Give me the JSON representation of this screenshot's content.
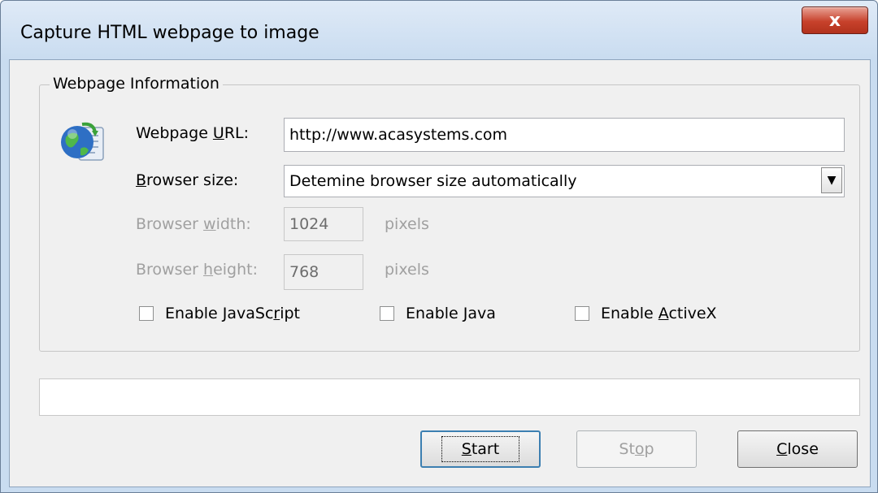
{
  "window": {
    "title": "Capture HTML webpage to image",
    "close_glyph": "x"
  },
  "group": {
    "legend": "Webpage Information",
    "icon": "globe-page-icon"
  },
  "url": {
    "label_pre": "Webpage ",
    "label_key": "U",
    "label_post": "RL:",
    "value": "http://www.acasystems.com"
  },
  "browser_size": {
    "label_key": "B",
    "label_post": "rowser size:",
    "selected": "Detemine browser size automatically"
  },
  "width": {
    "label_pre": "Browser ",
    "label_key": "w",
    "label_post": "idth:",
    "value": "1024",
    "unit": "pixels"
  },
  "height": {
    "label_pre": "Browser ",
    "label_key": "h",
    "label_post": "eight:",
    "value": "768",
    "unit": "pixels"
  },
  "options": {
    "javascript": {
      "pre": "Enable JavaSc",
      "key": "r",
      "post": "ipt",
      "checked": false
    },
    "java": {
      "pre": "Enable ",
      "key": "J",
      "post": "ava",
      "checked": false
    },
    "activex": {
      "pre": "Enable ",
      "key": "A",
      "post": "ctiveX",
      "checked": false
    }
  },
  "buttons": {
    "start": {
      "key": "S",
      "post": "tart"
    },
    "stop": {
      "pre": "St",
      "key": "o",
      "post": "p"
    },
    "close": {
      "key": "C",
      "post": "lose"
    }
  },
  "colors": {
    "accent": "#3c7fb1",
    "close_red": "#c7412b",
    "disabled_text": "#a0a0a0"
  }
}
